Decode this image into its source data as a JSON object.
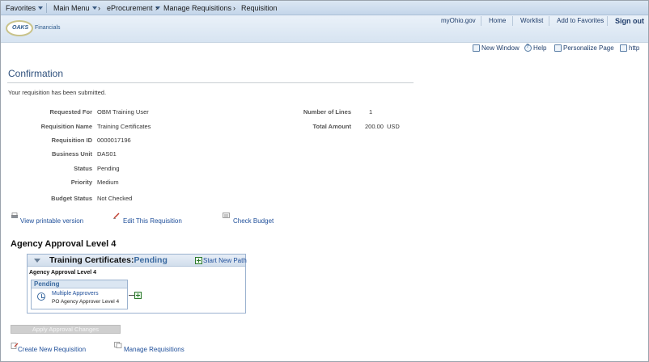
{
  "nav": {
    "favorites": "Favorites",
    "main_menu": "Main Menu",
    "eprocurement": "eProcurement",
    "manage_requisitions": "Manage Requisitions",
    "requisition": "Requisition",
    "sep_glyph": "›"
  },
  "header": {
    "logo_text": "OAKS",
    "logo_sub": "Financials",
    "links": {
      "myohio": "myOhio.gov",
      "home": "Home",
      "worklist": "Worklist",
      "add_to_favorites": "Add to Favorites",
      "sign_out": "Sign out"
    }
  },
  "toolbar": {
    "new_window": "New Window",
    "help": "Help",
    "personalize": "Personalize Page",
    "http": "http"
  },
  "page": {
    "title": "Confirmation",
    "message": "Your requisition has been submitted."
  },
  "fields_left": [
    {
      "label": "Requested For",
      "value": "OBM Training User"
    },
    {
      "label": "Requisition Name",
      "value": "Training Certificates"
    },
    {
      "label": "Requisition ID",
      "value": "0000017196"
    },
    {
      "label": "Business Unit",
      "value": "DAS01"
    },
    {
      "label": "Status",
      "value": "Pending"
    },
    {
      "label": "Priority",
      "value": "Medium"
    },
    {
      "label": "Budget Status",
      "value": "Not Checked"
    }
  ],
  "fields_right": [
    {
      "label": "Number of Lines",
      "value": "1",
      "unit": ""
    },
    {
      "label": "Total Amount",
      "value": "200.00",
      "unit": "USD"
    }
  ],
  "actions": {
    "printable": "View printable version",
    "edit": "Edit This Requisition",
    "check_budget": "Check Budget"
  },
  "approval": {
    "section_title": "Agency Approval Level 4",
    "box_title": "Training Certificates:",
    "box_status": "Pending",
    "start_new_path": "Start New Path",
    "level_label": "Agency Approval Level 4",
    "step_status": "Pending",
    "approver": "Multiple Approvers",
    "role": "PO Agency Approver Level 4",
    "apply_button": "Apply Approval Changes"
  },
  "footer_links": {
    "create": "Create New Requisition",
    "manage": "Manage Requisitions"
  }
}
